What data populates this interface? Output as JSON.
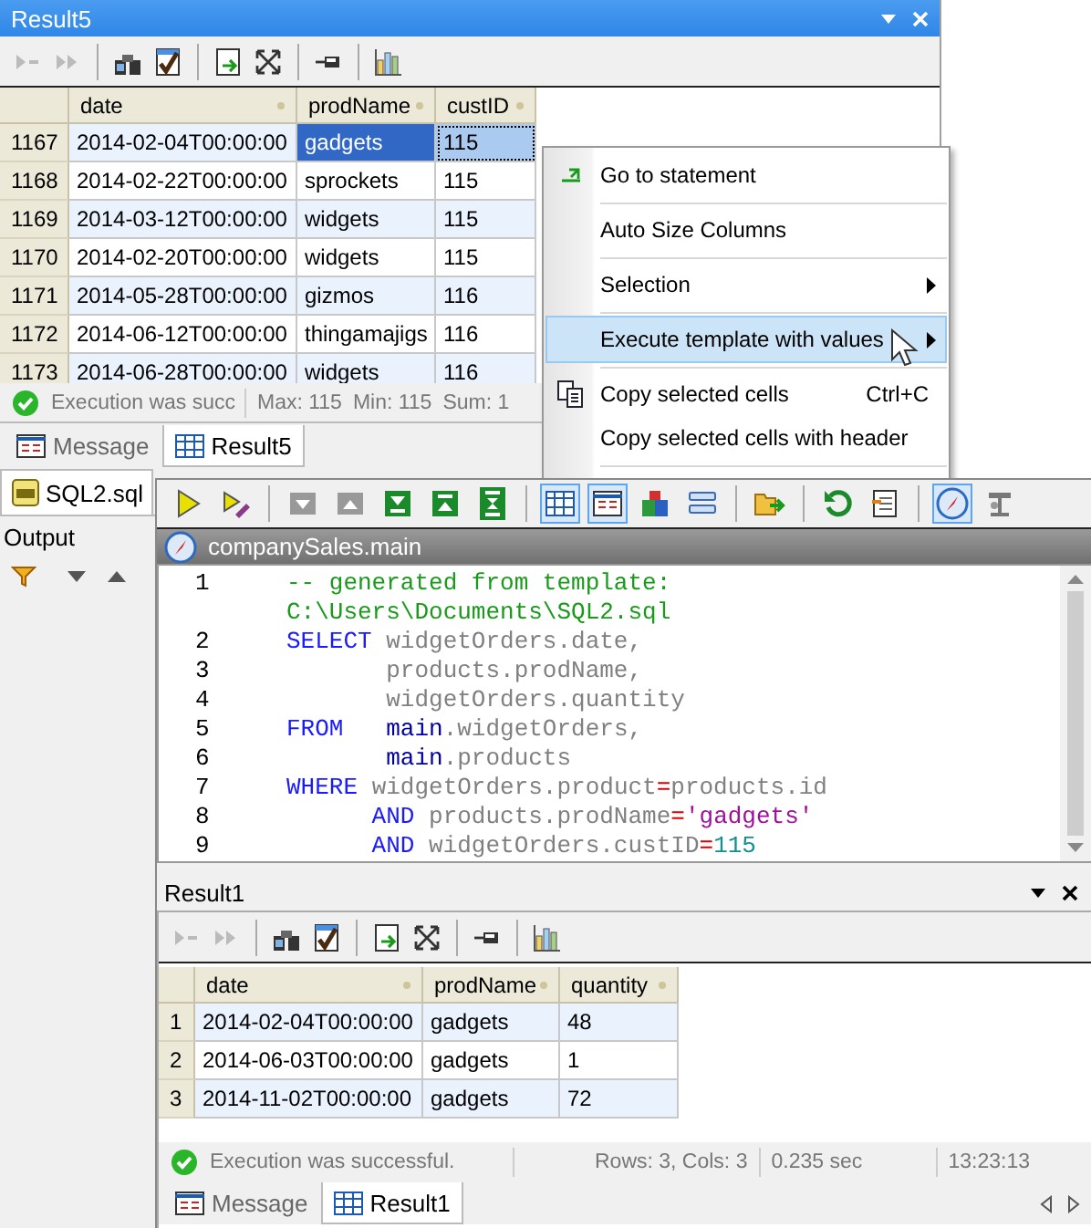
{
  "back_window": {
    "title": "Result5",
    "grid": {
      "columns": [
        "date",
        "prodName",
        "custID"
      ],
      "rows": [
        {
          "num": "1167",
          "cells": [
            {
              "text": "2014-02-04T00:00:00",
              "selected": false,
              "focused": false
            },
            {
              "text": "gadgets",
              "selected": true,
              "focused": false
            },
            {
              "text": "115",
              "selected": false,
              "focused": true
            }
          ]
        },
        {
          "num": "1168",
          "cells": [
            {
              "text": "2014-02-22T00:00:00",
              "selected": false,
              "focused": false
            },
            {
              "text": "sprockets",
              "selected": false,
              "focused": false
            },
            {
              "text": "115",
              "selected": false,
              "focused": false
            }
          ]
        },
        {
          "num": "1169",
          "cells": [
            {
              "text": "2014-03-12T00:00:00",
              "selected": false,
              "focused": false
            },
            {
              "text": "widgets",
              "selected": false,
              "focused": false
            },
            {
              "text": "115",
              "selected": false,
              "focused": false
            }
          ]
        },
        {
          "num": "1170",
          "cells": [
            {
              "text": "2014-02-20T00:00:00",
              "selected": false,
              "focused": false
            },
            {
              "text": "widgets",
              "selected": false,
              "focused": false
            },
            {
              "text": "115",
              "selected": false,
              "focused": false
            }
          ]
        },
        {
          "num": "1171",
          "cells": [
            {
              "text": "2014-05-28T00:00:00",
              "selected": false,
              "focused": false
            },
            {
              "text": "gizmos",
              "selected": false,
              "focused": false
            },
            {
              "text": "116",
              "selected": false,
              "focused": false
            }
          ]
        },
        {
          "num": "1172",
          "cells": [
            {
              "text": "2014-06-12T00:00:00",
              "selected": false,
              "focused": false
            },
            {
              "text": "thingamajigs",
              "selected": false,
              "focused": false
            },
            {
              "text": "116",
              "selected": false,
              "focused": false
            }
          ]
        },
        {
          "num": "1173",
          "cells": [
            {
              "text": "2014-06-28T00:00:00",
              "selected": false,
              "focused": false
            },
            {
              "text": "widgets",
              "selected": false,
              "focused": false
            },
            {
              "text": "116",
              "selected": false,
              "focused": false
            }
          ]
        }
      ]
    },
    "status": {
      "message": "Execution was succ",
      "stats": [
        "Max: 115",
        "Min: 115",
        "Sum: 1"
      ]
    },
    "tabs": [
      {
        "label": "Message",
        "selected": false
      },
      {
        "label": "Result5",
        "selected": true
      }
    ],
    "doc_tab": {
      "label": "SQL2.sql",
      "selected": true
    },
    "output_label": "Output"
  },
  "context_menu": [
    {
      "kind": "goto",
      "label": "Go to statement",
      "highlighted": false,
      "submenu": false,
      "separator_after": true
    },
    {
      "kind": "plain",
      "label": "Auto Size Columns",
      "highlighted": false,
      "submenu": false,
      "separator_after": true
    },
    {
      "kind": "plain",
      "label": "Selection",
      "highlighted": false,
      "submenu": true,
      "separator_after": true
    },
    {
      "kind": "plain",
      "label": "Execute template with values",
      "highlighted": true,
      "submenu": true,
      "separator_after": true
    },
    {
      "kind": "copy",
      "label": "Copy selected cells",
      "shortcut": "Ctrl+C",
      "highlighted": false,
      "submenu": false,
      "separator_after": false
    },
    {
      "kind": "plain",
      "label": "Copy selected cells with header",
      "highlighted": false,
      "submenu": false,
      "separator_after": true
    }
  ],
  "front_window": {
    "toolbar": [
      {
        "kind": "run",
        "pressed": false
      },
      {
        "kind": "runedit",
        "pressed": false
      },
      {
        "kind": "sep"
      },
      {
        "kind": "down",
        "pressed": false
      },
      {
        "kind": "up",
        "pressed": false
      },
      {
        "kind": "bottom",
        "pressed": false
      },
      {
        "kind": "top",
        "pressed": false
      },
      {
        "kind": "expand",
        "pressed": false
      },
      {
        "kind": "sep"
      },
      {
        "kind": "grid",
        "pressed": true
      },
      {
        "kind": "text",
        "pressed": true
      },
      {
        "kind": "blocks",
        "pressed": false
      },
      {
        "kind": "list",
        "pressed": false
      },
      {
        "kind": "sep"
      },
      {
        "kind": "export",
        "pressed": false
      },
      {
        "kind": "sep"
      },
      {
        "kind": "refresh",
        "pressed": false
      },
      {
        "kind": "script",
        "pressed": false
      },
      {
        "kind": "sep"
      },
      {
        "kind": "compass",
        "pressed": true
      },
      {
        "kind": "tools",
        "pressed": false
      }
    ],
    "title": "companySales.main",
    "code": [
      {
        "num": "1",
        "tokens": [
          {
            "kind": "comment",
            "text": "-- generated from template:"
          }
        ]
      },
      {
        "tokens": [
          {
            "kind": "comment",
            "text": "C:\\Users\\Documents\\SQL2.sql"
          }
        ]
      },
      {
        "num": "2",
        "tokens": [
          {
            "kind": "keyword",
            "text": "SELECT"
          },
          {
            "kind": "ident",
            "text": " widgetOrders.date,"
          }
        ]
      },
      {
        "num": "3",
        "tokens": [
          {
            "kind": "ident",
            "text": "       products.prodName,"
          }
        ]
      },
      {
        "num": "4",
        "tokens": [
          {
            "kind": "ident",
            "text": "       widgetOrders.quantity"
          }
        ]
      },
      {
        "num": "5",
        "tokens": [
          {
            "kind": "keyword",
            "text": "FROM"
          },
          {
            "kind": "schema",
            "text": "   main"
          },
          {
            "kind": "ident",
            "text": ".widgetOrders,"
          }
        ]
      },
      {
        "num": "6",
        "tokens": [
          {
            "kind": "schema",
            "text": "       main"
          },
          {
            "kind": "ident",
            "text": ".products"
          }
        ]
      },
      {
        "num": "7",
        "tokens": [
          {
            "kind": "keyword",
            "text": "WHERE"
          },
          {
            "kind": "ident",
            "text": " widgetOrders.product"
          },
          {
            "kind": "op",
            "text": "="
          },
          {
            "kind": "ident",
            "text": "products.id"
          }
        ]
      },
      {
        "num": "8",
        "tokens": [
          {
            "kind": "keyword",
            "text": "      AND"
          },
          {
            "kind": "ident",
            "text": " products.prodName"
          },
          {
            "kind": "op",
            "text": "="
          },
          {
            "kind": "string",
            "text": "'gadgets'"
          }
        ]
      },
      {
        "num": "9",
        "tokens": [
          {
            "kind": "keyword",
            "text": "      AND"
          },
          {
            "kind": "ident",
            "text": " widgetOrders.custID"
          },
          {
            "kind": "op",
            "text": "="
          },
          {
            "kind": "number",
            "text": "115"
          }
        ]
      }
    ],
    "result": {
      "title": "Result1",
      "columns": [
        "date",
        "prodName",
        "quantity"
      ],
      "rows": [
        {
          "num": "1",
          "cells": [
            "2014-02-04T00:00:00",
            "gadgets",
            "48"
          ]
        },
        {
          "num": "2",
          "cells": [
            "2014-06-03T00:00:00",
            "gadgets",
            "1"
          ]
        },
        {
          "num": "3",
          "cells": [
            "2014-11-02T00:00:00",
            "gadgets",
            "72"
          ]
        }
      ],
      "status": {
        "message": "Execution was successful.",
        "rows": "Rows: 3, Cols: 3",
        "time": "0.235 sec",
        "clock": "13:23:13"
      },
      "tabs": [
        {
          "label": "Message",
          "selected": false
        },
        {
          "label": "Result1",
          "selected": true
        }
      ]
    }
  }
}
